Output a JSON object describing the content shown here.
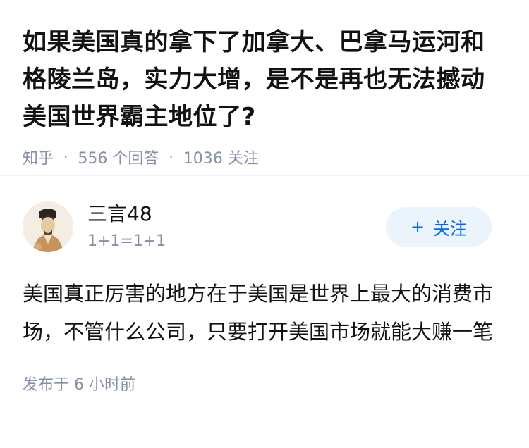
{
  "question": {
    "title": "如果美国真的拿下了加拿大、巴拿马运河和格陵兰岛，实力大增，是不是再也无法撼动美国世界霸主地位了?",
    "source": "知乎",
    "separator": "·",
    "answers_count": "556 个回答",
    "followers_count": "1036 关注"
  },
  "answer": {
    "author": {
      "name": "三言48",
      "bio": "1+1=1+1",
      "avatar_icon": "avatar-portrait"
    },
    "follow_button": {
      "icon": "+",
      "label": "关注"
    },
    "content": "美国真正厉害的地方在于美国是世界上最大的消费市场，不管什么公司，只要打开美国市场就能大赚一笔",
    "published": "发布于 6 小时前"
  },
  "colors": {
    "text_primary": "#121212",
    "text_secondary": "#8590a6",
    "accent": "#0066ff",
    "button_bg": "#ebf3fb",
    "divider": "#f0f2f7"
  }
}
